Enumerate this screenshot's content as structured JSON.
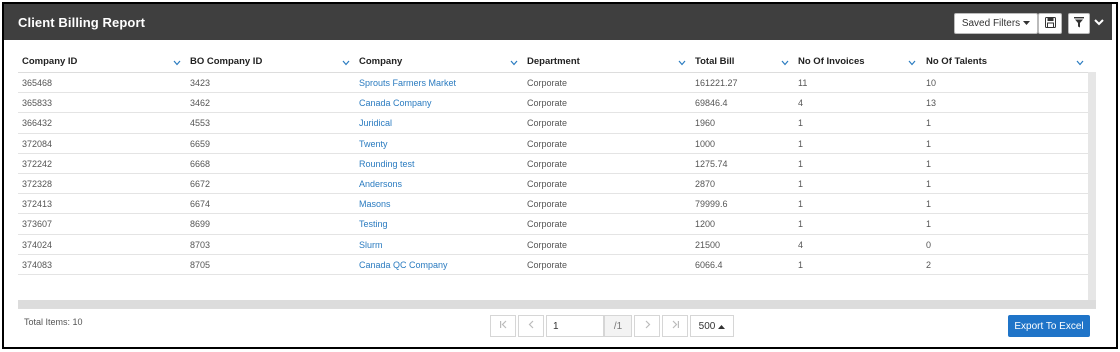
{
  "header": {
    "title": "Client Billing Report",
    "saved_filters_label": "Saved Filters"
  },
  "grid": {
    "columns": [
      "Company ID",
      "BO Company ID",
      "Company",
      "Department",
      "Total Bill",
      "No Of Invoices",
      "No Of Talents"
    ],
    "rows": [
      [
        "365468",
        "3423",
        "Sprouts Farmers Market",
        "Corporate",
        "161221.27",
        "11",
        "10"
      ],
      [
        "365833",
        "3462",
        "Canada Company",
        "Corporate",
        "69846.4",
        "4",
        "13"
      ],
      [
        "366432",
        "4553",
        "Juridical",
        "Corporate",
        "1960",
        "1",
        "1"
      ],
      [
        "372084",
        "6659",
        "Twenty",
        "Corporate",
        "1000",
        "1",
        "1"
      ],
      [
        "372242",
        "6668",
        "Rounding test",
        "Corporate",
        "1275.74",
        "1",
        "1"
      ],
      [
        "372328",
        "6672",
        "Andersons",
        "Corporate",
        "2870",
        "1",
        "1"
      ],
      [
        "372413",
        "6674",
        "Masons",
        "Corporate",
        "79999.6",
        "1",
        "1"
      ],
      [
        "373607",
        "8699",
        "Testing",
        "Corporate",
        "1200",
        "1",
        "1"
      ],
      [
        "374024",
        "8703",
        "Slurm",
        "Corporate",
        "21500",
        "4",
        "0"
      ],
      [
        "374083",
        "8705",
        "Canada QC Company",
        "Corporate",
        "6066.4",
        "1",
        "2"
      ]
    ]
  },
  "footer": {
    "total_items": "Total Items: 10",
    "page_value": "1",
    "page_of": "/1",
    "page_size": "500",
    "export_label": "Export To Excel"
  },
  "colors": {
    "titlebar": "#3f3f3f",
    "link": "#2a7bc0",
    "export_button": "#1f74c8"
  },
  "icons": [
    "caret-down-icon",
    "save-icon",
    "filter-icon",
    "chevron-down-icon",
    "first-page-icon",
    "prev-page-icon",
    "next-page-icon",
    "last-page-icon",
    "caret-up-icon"
  ]
}
